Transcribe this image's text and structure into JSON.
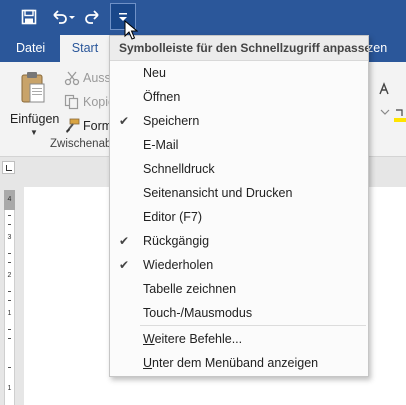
{
  "quick_access": {
    "save_icon": "save-icon",
    "undo_icon": "undo-icon",
    "redo_icon": "redo-icon",
    "customize_icon": "customize-quick-access-icon"
  },
  "tabs": {
    "datei": "Datei",
    "start": "Start",
    "partial": "zen"
  },
  "clipboard": {
    "paste_label": "Einfügen",
    "cut_label": "Auss",
    "copy_label": "Kopie",
    "format_label": "Form",
    "group_label": "Zwischenab"
  },
  "ruler": {
    "numbers": [
      "4",
      "3",
      "2",
      "1",
      "1"
    ]
  },
  "menu": {
    "title": "Symbolleiste für den Schnellzugriff anpassen",
    "items": [
      {
        "label": "Neu",
        "checked": false
      },
      {
        "label": "Öffnen",
        "checked": false
      },
      {
        "label": "Speichern",
        "checked": true
      },
      {
        "label": "E-Mail",
        "checked": false
      },
      {
        "label": "Schnelldruck",
        "checked": false
      },
      {
        "label": "Seitenansicht und Drucken",
        "checked": false
      },
      {
        "label": "Editor (F7)",
        "checked": false
      },
      {
        "label": "Rückgängig",
        "checked": true
      },
      {
        "label": "Wiederholen",
        "checked": true
      },
      {
        "label": "Tabelle zeichnen",
        "checked": false
      },
      {
        "label": "Touch-/Mausmodus",
        "checked": false
      }
    ],
    "more_commands": "Weitere Befehle...",
    "show_below": "Unter dem Menüband anzeigen",
    "check_glyph": "✔"
  },
  "colors": {
    "brand": "#2b579a",
    "ribbon": "#f3f3f3"
  }
}
